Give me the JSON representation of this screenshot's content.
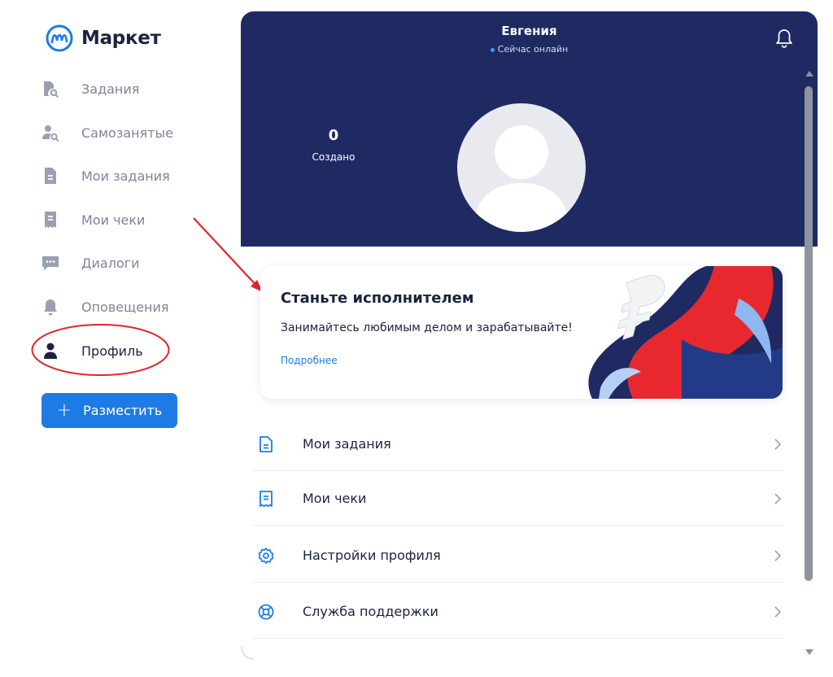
{
  "brand": {
    "name": "Маркет"
  },
  "sidebar": {
    "items": [
      {
        "label": "Задания",
        "icon": "task-search-icon"
      },
      {
        "label": "Самозанятые",
        "icon": "user-search-icon"
      },
      {
        "label": "Мои задания",
        "icon": "document-icon"
      },
      {
        "label": "Мои чеки",
        "icon": "receipt-icon"
      },
      {
        "label": "Диалоги",
        "icon": "chat-icon"
      },
      {
        "label": "Оповещения",
        "icon": "bell-icon"
      },
      {
        "label": "Профиль",
        "icon": "user-icon",
        "active": true
      }
    ],
    "place_button": {
      "label": "Разместить",
      "icon": "plus-icon"
    }
  },
  "profile": {
    "name": "Евгения",
    "status": "Сейчас онлайн",
    "stat_value": "0",
    "stat_label": "Создано"
  },
  "promo": {
    "title": "Станьте исполнителем",
    "text": "Занимайтесь любимым делом и зарабатывайте!",
    "link": "Подробнее"
  },
  "menu": [
    {
      "label": "Мои задания",
      "icon": "document-icon"
    },
    {
      "label": "Мои чеки",
      "icon": "receipt-icon"
    },
    {
      "label": "Настройки профиля",
      "icon": "settings-icon"
    },
    {
      "label": "Служба поддержки",
      "icon": "lifebuoy-icon"
    }
  ],
  "colors": {
    "hero_bg": "#1f2a63",
    "accent": "#1e7be4",
    "annotation": "#e0262b",
    "text_muted": "#7f8598"
  }
}
